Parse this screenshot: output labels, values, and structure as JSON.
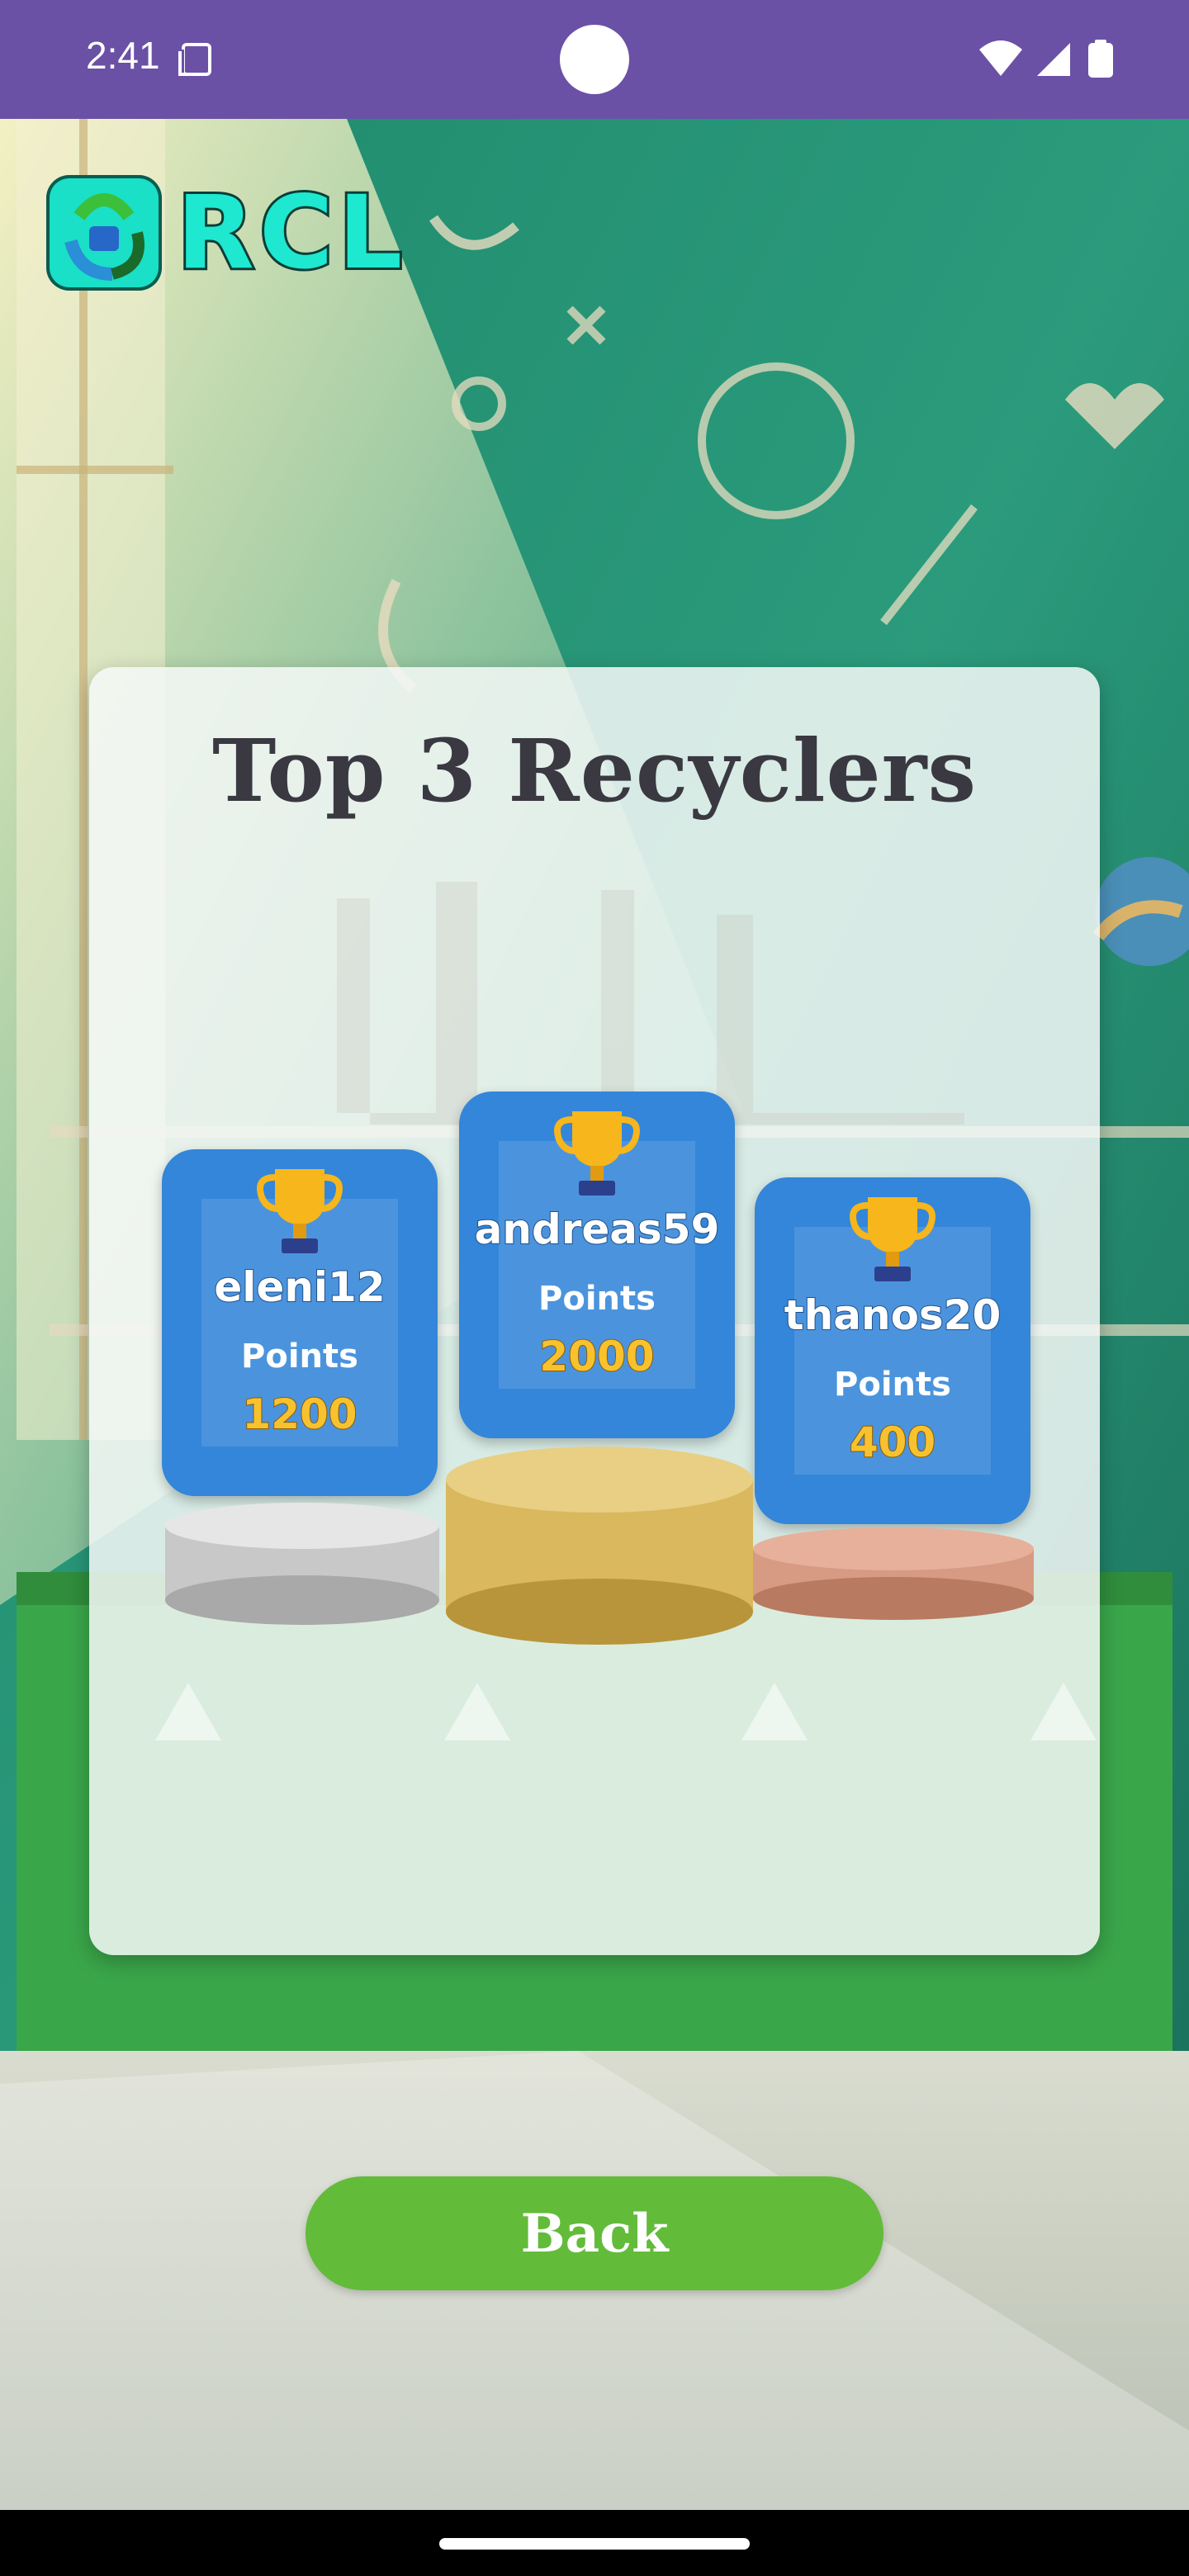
{
  "status_bar": {
    "time": "2:41",
    "icons": [
      "sim-card-icon",
      "wifi-icon",
      "signal-icon",
      "battery-icon"
    ]
  },
  "app": {
    "logo_text": "RCL",
    "logo_icon": "recycle-leaves-icon"
  },
  "leaderboard": {
    "title": "Top 3 Recyclers",
    "points_label": "Points",
    "players": [
      {
        "rank": 2,
        "name": "eleni12",
        "points": "1200",
        "pedestal": "silver"
      },
      {
        "rank": 1,
        "name": "andreas59",
        "points": "2000",
        "pedestal": "gold"
      },
      {
        "rank": 3,
        "name": "thanos20",
        "points": "400",
        "pedestal": "bronze"
      }
    ]
  },
  "actions": {
    "back_label": "Back"
  },
  "colors": {
    "status_bar": "#6a51a6",
    "card_blue": "#3386d9",
    "points_gold": "#f8c22e",
    "back_green": "#62bc3a",
    "title_dark": "#3a3841"
  }
}
